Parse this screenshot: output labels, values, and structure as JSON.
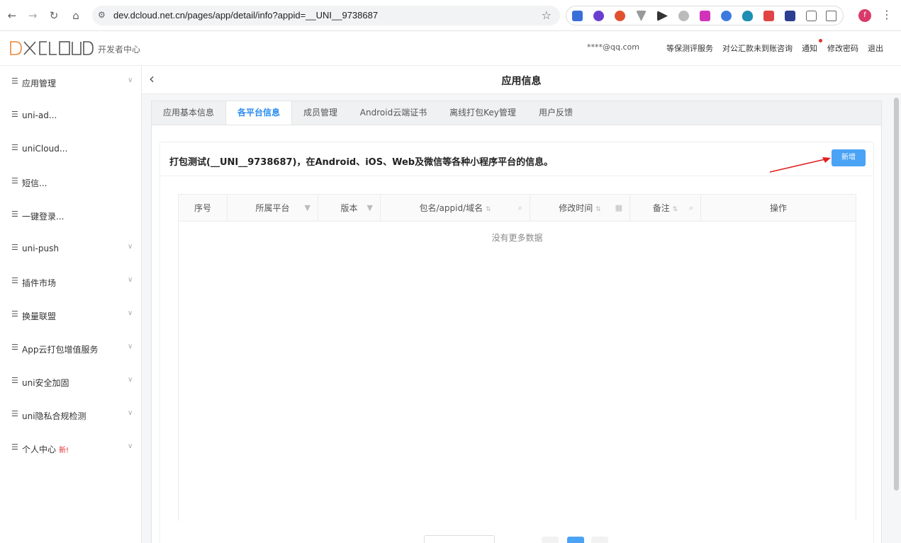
{
  "browser": {
    "url": "dev.dcloud.net.cn/pages/app/detail/info?appid=__UNI__9738687",
    "profile_initial": "f"
  },
  "header": {
    "logo_text": "DCLOUD",
    "logo_sub": "开发者中心",
    "user": "****@qq.com",
    "links": [
      "等保测评服务",
      "对公汇款未到账咨询",
      "通知",
      "修改密码",
      "退出"
    ]
  },
  "sidebar": {
    "items": [
      {
        "label": "应用管理",
        "chevron": true
      },
      {
        "label": "uni-ad...",
        "chevron": false
      },
      {
        "label": "uniCloud...",
        "chevron": false
      },
      {
        "label": "短信...",
        "chevron": false
      },
      {
        "label": "一键登录...",
        "chevron": false
      },
      {
        "label": "uni-push",
        "chevron": true
      },
      {
        "label": "插件市场",
        "chevron": true
      },
      {
        "label": "换量联盟",
        "chevron": true
      },
      {
        "label": "App云打包增值服务",
        "chevron": true
      },
      {
        "label": "uni安全加固",
        "chevron": true
      },
      {
        "label": "uni隐私合规检测",
        "chevron": true
      },
      {
        "label": "个人中心",
        "chevron": true,
        "badge": "新!"
      }
    ]
  },
  "page": {
    "title": "应用信息",
    "tabs": [
      "应用基本信息",
      "各平台信息",
      "成员管理",
      "Android云端证书",
      "离线打包Key管理",
      "用户反馈"
    ],
    "active_tab": "各平台信息",
    "description": "打包测试(__UNI__9738687)，在Android、iOS、Web及微信等各种小程序平台的信息。",
    "add_button": "新增",
    "columns": [
      "序号",
      "所属平台",
      "版本",
      "包名/appid/域名",
      "修改时间",
      "备注",
      "操作"
    ],
    "empty_text": "没有更多数据",
    "accent_color": "#2b8cf0",
    "arrow_color": "#e02020"
  }
}
